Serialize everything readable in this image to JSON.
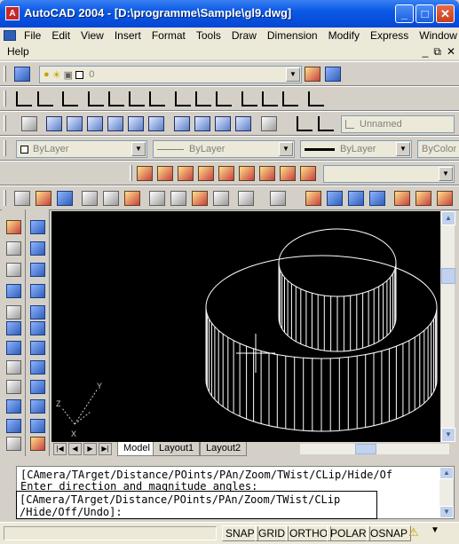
{
  "window": {
    "title": "AutoCAD 2004 - [D:\\programme\\Sample\\gl9.dwg]",
    "minimize": "_",
    "maximize": "□",
    "close": "✕"
  },
  "menu": {
    "items": [
      "File",
      "Edit",
      "View",
      "Insert",
      "Format",
      "Tools",
      "Draw",
      "Dimension",
      "Modify",
      "Express",
      "Window"
    ],
    "second_row": [
      "Help"
    ],
    "mdi": [
      "_",
      "⧉",
      "✕"
    ]
  },
  "toolbars": {
    "layer_value": "0",
    "named_view": "Unnamed",
    "color": "ByLayer",
    "linetype": "ByLayer",
    "lineweight": "ByLayer",
    "plotstyle": "ByColor"
  },
  "layout_tabs": {
    "tabs": [
      "Model",
      "Layout1",
      "Layout2"
    ],
    "active": "Model",
    "nav": [
      "|◀",
      "◀",
      "▶",
      "▶|"
    ]
  },
  "ucs": {
    "x_label": "X",
    "y_label": "Y",
    "z_label": "Z"
  },
  "command": {
    "line1": "[CAmera/TArget/Distance/POints/PAn/Zoom/TWist/CLip/Hide/Of",
    "line2": "Enter direction and magnitude angles:",
    "line3": "[CAmera/TArget/Distance/POints/PAn/Zoom/TWist/CLip",
    "line4": "/Hide/Off/Undo]:"
  },
  "status": {
    "buttons": [
      "SNAP",
      "GRID",
      "ORTHO",
      "POLAR",
      "OSNAP"
    ]
  },
  "colors": {
    "title_bar": "#0a5ae6",
    "viewport": "#000000",
    "wireframe": "#ffffff"
  },
  "icons": {
    "app": "autocad-icon",
    "tray": [
      "warning-icon",
      "arrow-down-icon"
    ]
  }
}
